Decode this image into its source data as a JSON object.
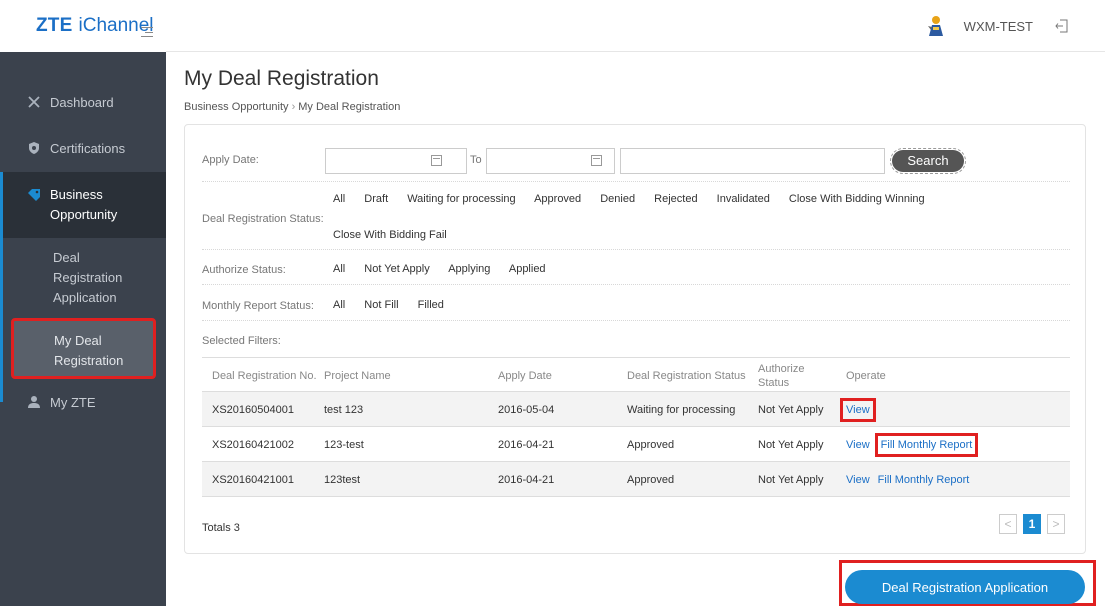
{
  "header": {
    "brand": "ZTE",
    "product": "iChannel",
    "user_name": "WXM-TEST",
    "icons": {
      "menu": "menu-toggle-icon",
      "avatar": "user-avatar-icon",
      "logout": "logout-icon"
    }
  },
  "sidebar": {
    "items": [
      {
        "label": "Dashboard",
        "icon": "tools-icon"
      },
      {
        "label": "Certifications",
        "icon": "shield-icon"
      },
      {
        "label": "Business Opportunity",
        "icon": "tag-icon"
      },
      {
        "label": "My ZTE",
        "icon": "user-icon"
      }
    ],
    "sub_items": [
      "Deal Registration Application",
      "My Deal Registration"
    ]
  },
  "page": {
    "title": "My Deal Registration",
    "breadcrumb": [
      "Business Opportunity",
      "My Deal Registration"
    ]
  },
  "filters": {
    "apply_date_label": "Apply Date:",
    "to_label": "To",
    "search_label": "Search",
    "deal_status_label": "Deal Registration Status:",
    "deal_status_options_row1": [
      "All",
      "Draft",
      "Waiting for processing",
      "Approved",
      "Denied",
      "Rejected",
      "Invalidated",
      "Close With Bidding Winning"
    ],
    "deal_status_options_row2": [
      "Close With Bidding Fail"
    ],
    "authorize_status_label": "Authorize Status:",
    "authorize_status_options": [
      "All",
      "Not Yet Apply",
      "Applying",
      "Applied"
    ],
    "monthly_report_label": "Monthly Report Status:",
    "monthly_report_options": [
      "All",
      "Not Fill",
      "Filled"
    ],
    "selected_filters_label": "Selected Filters:"
  },
  "table": {
    "headers": [
      "Deal Registration No.",
      "Project Name",
      "Apply Date",
      "Deal Registration Status",
      "Authorize Status",
      "Operate"
    ],
    "rows": [
      {
        "no": "XS20160504001",
        "project": "test 123",
        "date": "2016-05-04",
        "status": "Waiting for processing",
        "authorize": "Not Yet Apply",
        "ops": [
          "View"
        ]
      },
      {
        "no": "XS20160421002",
        "project": "123-test",
        "date": "2016-04-21",
        "status": "Approved",
        "authorize": "Not Yet Apply",
        "ops": [
          "View",
          "Fill Monthly Report"
        ]
      },
      {
        "no": "XS20160421001",
        "project": "123test",
        "date": "2016-04-21",
        "status": "Approved",
        "authorize": "Not Yet Apply",
        "ops": [
          "View",
          "Fill Monthly Report"
        ]
      }
    ],
    "totals": "Totals 3"
  },
  "pagination": {
    "prev": "<",
    "current": "1",
    "next": ">"
  },
  "actions": {
    "deal_app_button": "Deal Registration Application"
  },
  "colors": {
    "accent": "#1b8bd1",
    "highlight": "#e02020",
    "sidebar_bg": "#3b424d"
  }
}
